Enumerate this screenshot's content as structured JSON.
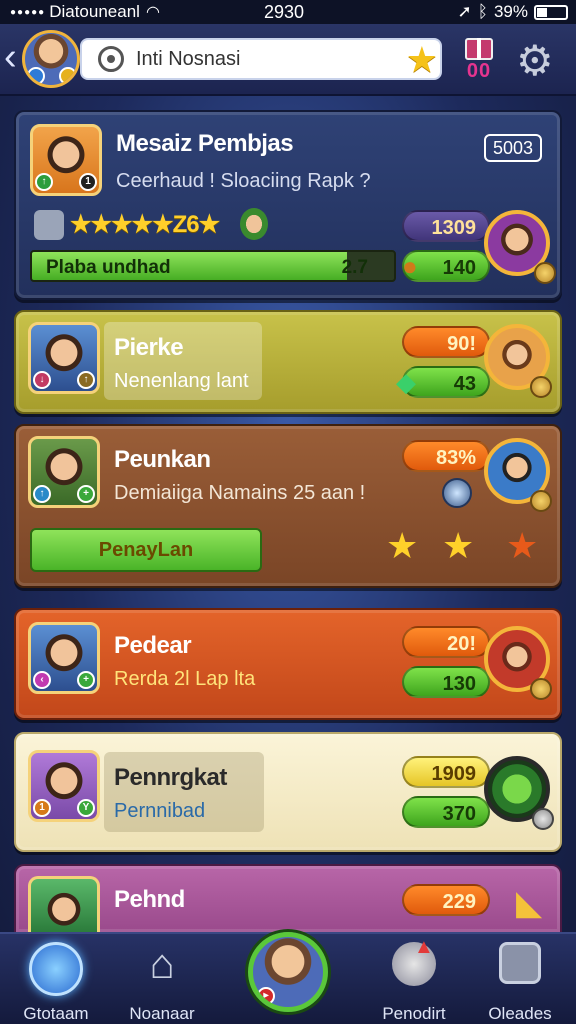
{
  "status_bar": {
    "carrier": "Diatouneanl",
    "time": "2930",
    "battery": "39%"
  },
  "header": {
    "search_value": "Inti Nosnasi",
    "gift_count": "00",
    "icons": [
      "back-chevron-icon",
      "target-icon",
      "star-icon",
      "gift-icon",
      "gear-icon"
    ]
  },
  "cards": [
    {
      "title": "Mesaiz Pembjas",
      "subtitle": "Ceerhaud ! Sloaciing Rapk ?",
      "badge_box": "5003",
      "rating_text": "★★★★★Z6★",
      "pill": "1309",
      "progress_label": "Plaba  undhad",
      "progress_value": "2.7",
      "progress_fraction": 0.87,
      "pill2": "140",
      "color": "#2b3c6e"
    },
    {
      "title": "Pierke",
      "subtitle": "Nenenlang lant",
      "pill": "90!",
      "pill2": "43",
      "color": "#b7b03a"
    },
    {
      "title": "Peunkan",
      "subtitle": "Demiaiiga Namains 25 aan !",
      "pill": "83%",
      "button": "PenayLan",
      "color": "#8a5230"
    },
    {
      "title": "Pedear",
      "subtitle": "Rerda 2l Lap lta",
      "pill": "20!",
      "pill2": "130",
      "color": "#d8541c"
    },
    {
      "title": "Pennrgkat",
      "subtitle": "Pernnibad",
      "pill": "1909",
      "pill2": "370",
      "color": "#f4ecc9"
    },
    {
      "title": "Pehnd",
      "pill": "229",
      "color": "#a85a9c"
    }
  ],
  "bottom_nav": {
    "items": [
      {
        "label": "Gtotaam",
        "icon": "globe-icon"
      },
      {
        "label": "Noanaar",
        "icon": "home-icon"
      },
      {
        "label": "",
        "icon": "profile-avatar"
      },
      {
        "label": "Penodirt",
        "icon": "rocket-icon"
      },
      {
        "label": "Oleades",
        "icon": "trophy-icon"
      }
    ]
  }
}
